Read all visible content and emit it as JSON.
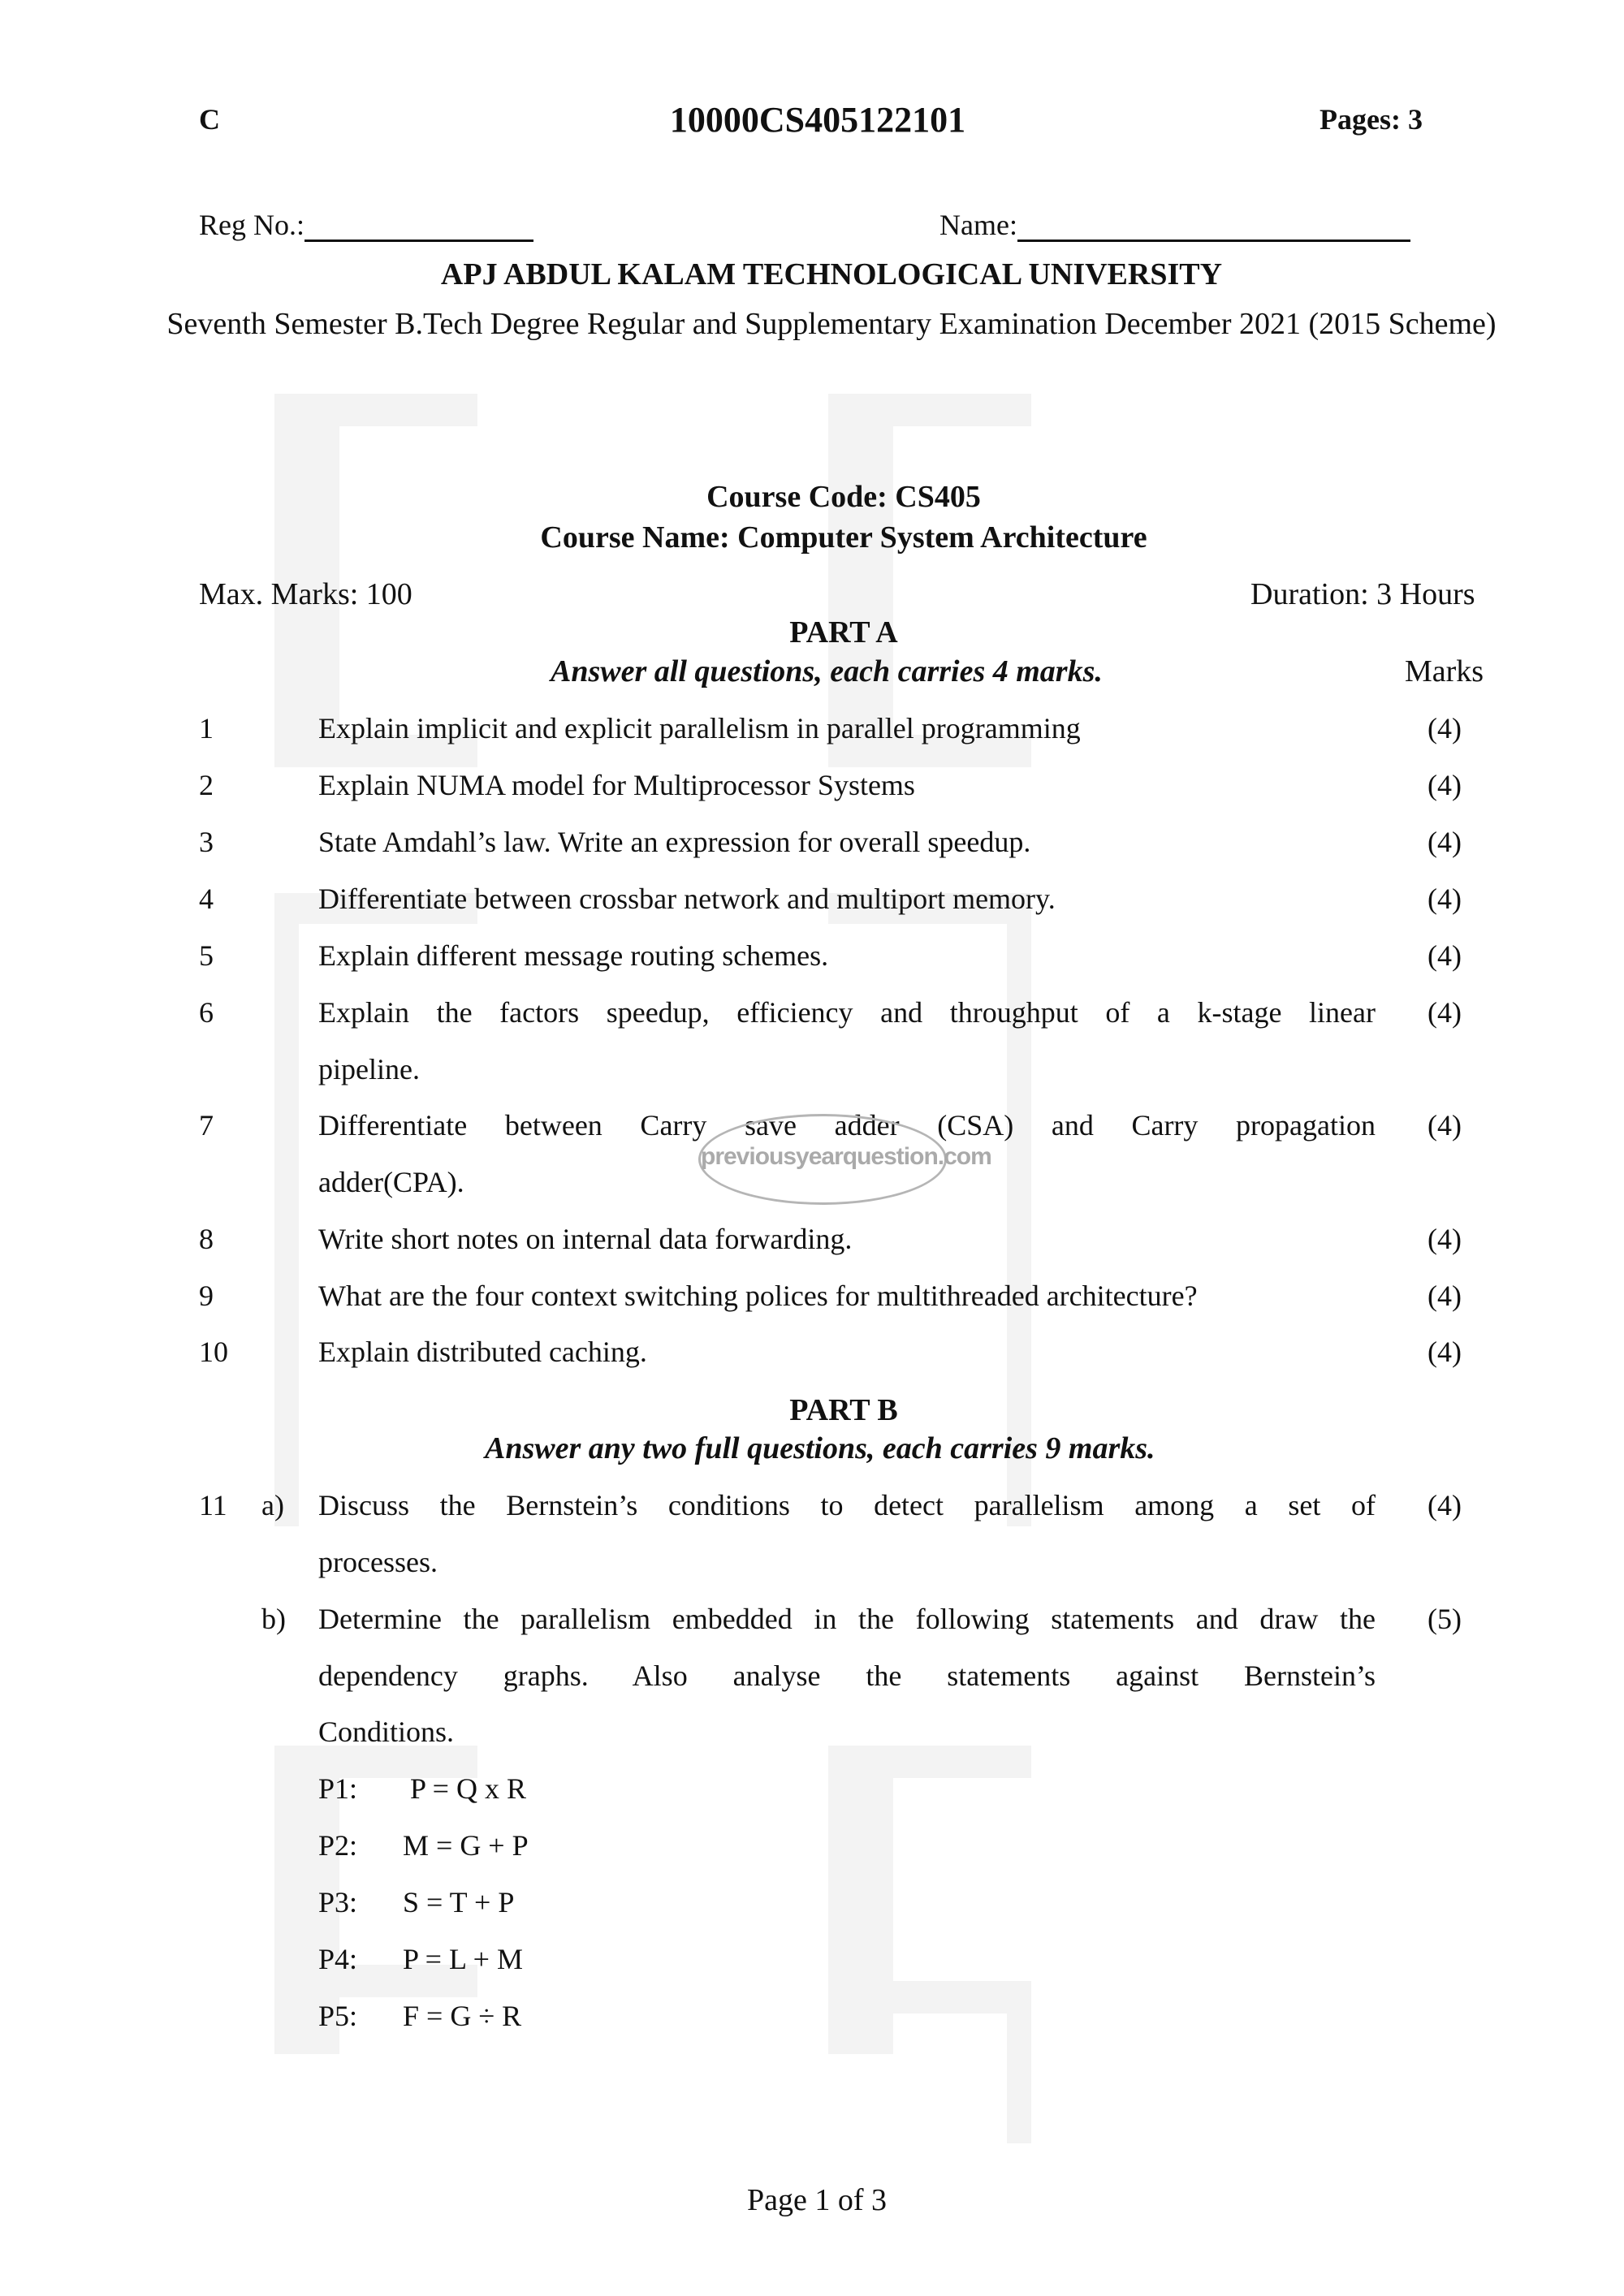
{
  "header": {
    "set_code": "C",
    "paper_code": "10000CS405122101",
    "pages": "Pages: 3"
  },
  "student": {
    "reg_label": "Reg No.:",
    "name_label": "Name:"
  },
  "university": "APJ ABDUL KALAM TECHNOLOGICAL UNIVERSITY",
  "exam_title": "Seventh Semester B.Tech Degree Regular and Supplementary Examination December 2021 (2015 Scheme)",
  "course": {
    "code": "Course Code: CS405",
    "name": "Course Name: Computer System Architecture"
  },
  "meta": {
    "max_marks": "Max. Marks: 100",
    "duration": "Duration: 3 Hours"
  },
  "watermark_stamp": "previousyearquestion.com",
  "part_a": {
    "title": "PART A",
    "instruction": "Answer all questions, each carries 4 marks.",
    "marks_header": "Marks",
    "questions": [
      {
        "num": "1",
        "text": "Explain implicit and explicit parallelism in parallel programming",
        "marks": "(4)"
      },
      {
        "num": "2",
        "text": "Explain NUMA model for Multiprocessor Systems",
        "marks": "(4)"
      },
      {
        "num": "3",
        "text": "State Amdahl’s law. Write an expression for overall speedup.",
        "marks": "(4)"
      },
      {
        "num": "4",
        "text": "Differentiate between crossbar network and multiport memory.",
        "marks": "(4)"
      },
      {
        "num": "5",
        "text": "Explain different message routing schemes.",
        "marks": "(4)"
      },
      {
        "num": "6",
        "text_line1": "Explain the factors speedup, efficiency and throughput of a k-stage linear",
        "text_line2": "pipeline.",
        "marks": "(4)"
      },
      {
        "num": "7",
        "text_line1": "Differentiate between Carry save adder (CSA) and Carry propagation",
        "text_line2": "adder(CPA).",
        "marks": "(4)"
      },
      {
        "num": "8",
        "text": "Write short notes on internal data forwarding.",
        "marks": "(4)"
      },
      {
        "num": "9",
        "text": "What are the four context switching polices for multithreaded architecture?",
        "marks": "(4)"
      },
      {
        "num": "10",
        "text": "Explain distributed caching.",
        "marks": "(4)"
      }
    ]
  },
  "part_b": {
    "title": "PART B",
    "instruction": "Answer any two full questions, each carries 9 marks.",
    "q11": {
      "num": "11",
      "a": {
        "label": "a)",
        "text_line1": "Discuss the Bernstein’s conditions to detect parallelism among a set of",
        "text_line2": "processes.",
        "marks": "(4)"
      },
      "b": {
        "label": "b)",
        "text_line1": "Determine the parallelism embedded in the following statements and draw the",
        "text_line2": "dependency graphs. Also analyse the statements against Bernstein’s",
        "text_line3": "Conditions.",
        "marks": "(5)"
      },
      "statements": [
        {
          "label": "P1:",
          "expr": "P = Q x R"
        },
        {
          "label": "P2:",
          "expr": "M = G + P"
        },
        {
          "label": "P3:",
          "expr": "S = T + P"
        },
        {
          "label": "P4:",
          "expr": "P = L + M"
        },
        {
          "label": "P5:",
          "expr": "F = G ÷ R"
        }
      ]
    }
  },
  "footer": "Page 1 of 3"
}
